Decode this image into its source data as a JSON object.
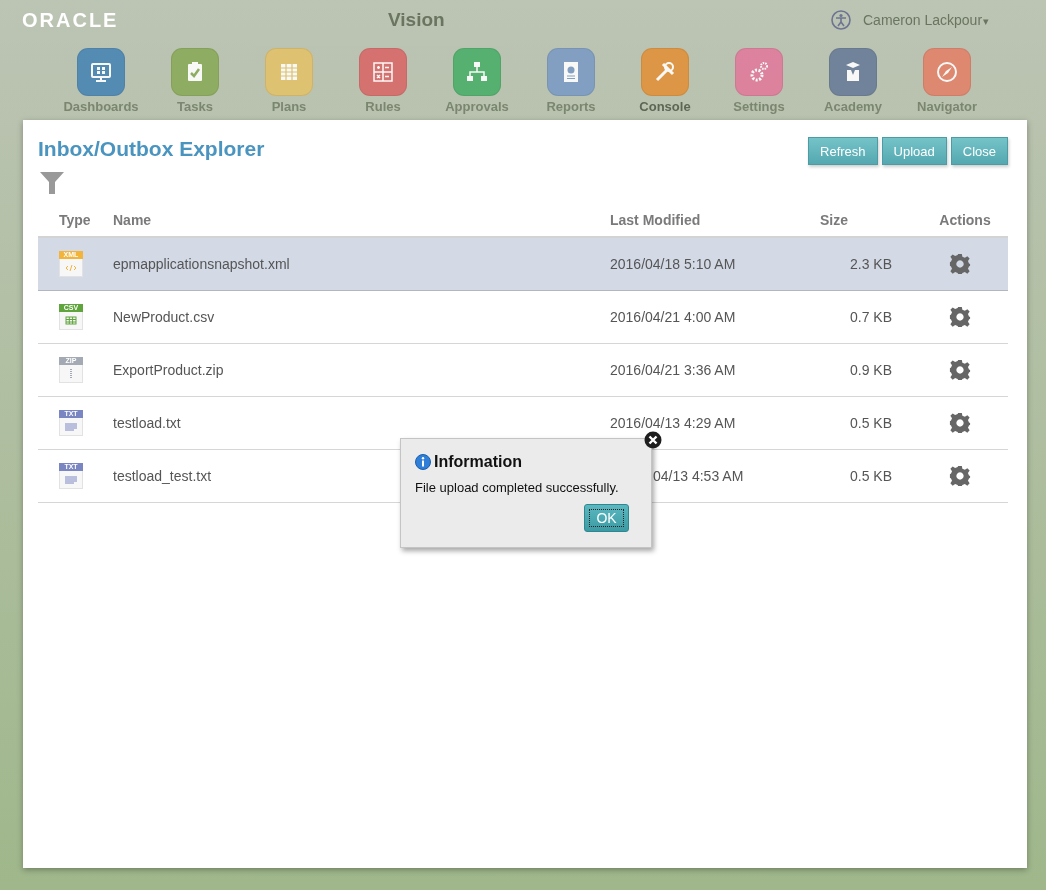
{
  "header": {
    "logo": "ORACLE",
    "app_title": "Vision",
    "user": "Cameron Lackpour",
    "user_caret": "▾"
  },
  "nav": [
    {
      "label": "Dashboards",
      "color": "#4a86b4",
      "selected": false
    },
    {
      "label": "Tasks",
      "color": "#8aab5a",
      "selected": false
    },
    {
      "label": "Plans",
      "color": "#e2c26c",
      "selected": false
    },
    {
      "label": "Rules",
      "color": "#d86a6a",
      "selected": false
    },
    {
      "label": "Approvals",
      "color": "#4cae6a",
      "selected": false
    },
    {
      "label": "Reports",
      "color": "#7c9cc4",
      "selected": false
    },
    {
      "label": "Console",
      "color": "#e0923a",
      "selected": true
    },
    {
      "label": "Settings",
      "color": "#e07c9c",
      "selected": false
    },
    {
      "label": "Academy",
      "color": "#6a7d98",
      "selected": false
    },
    {
      "label": "Navigator",
      "color": "#e2826a",
      "selected": false
    }
  ],
  "explorer": {
    "title": "Inbox/Outbox Explorer",
    "buttons": [
      "Refresh",
      "Upload",
      "Close"
    ],
    "columns": [
      "Type",
      "Name",
      "Last Modified",
      "Size",
      "Actions"
    ],
    "rows": [
      {
        "kind": "xml",
        "type_label": "XML",
        "name": "epmapplicationsnapshot.xml",
        "modified": "2016/04/18 5:10 AM",
        "size": "2.3 KB",
        "selected": true
      },
      {
        "kind": "csv",
        "type_label": "CSV",
        "name": "NewProduct.csv",
        "modified": "2016/04/21 4:00 AM",
        "size": "0.7 KB",
        "selected": false
      },
      {
        "kind": "zip",
        "type_label": "ZIP",
        "name": "ExportProduct.zip",
        "modified": "2016/04/21 3:36 AM",
        "size": "0.9 KB",
        "selected": false
      },
      {
        "kind": "txt",
        "type_label": "TXT",
        "name": "testload.txt",
        "modified": "2016/04/13 4:29 AM",
        "size": "0.5 KB",
        "selected": false
      },
      {
        "kind": "txt",
        "type_label": "TXT",
        "name": "testload_test.txt",
        "modified": "04/13 4:53 AM",
        "size": "0.5 KB",
        "selected": false
      }
    ]
  },
  "dialog": {
    "title": "Information",
    "message": "File upload completed successfully.",
    "button": "OK"
  }
}
